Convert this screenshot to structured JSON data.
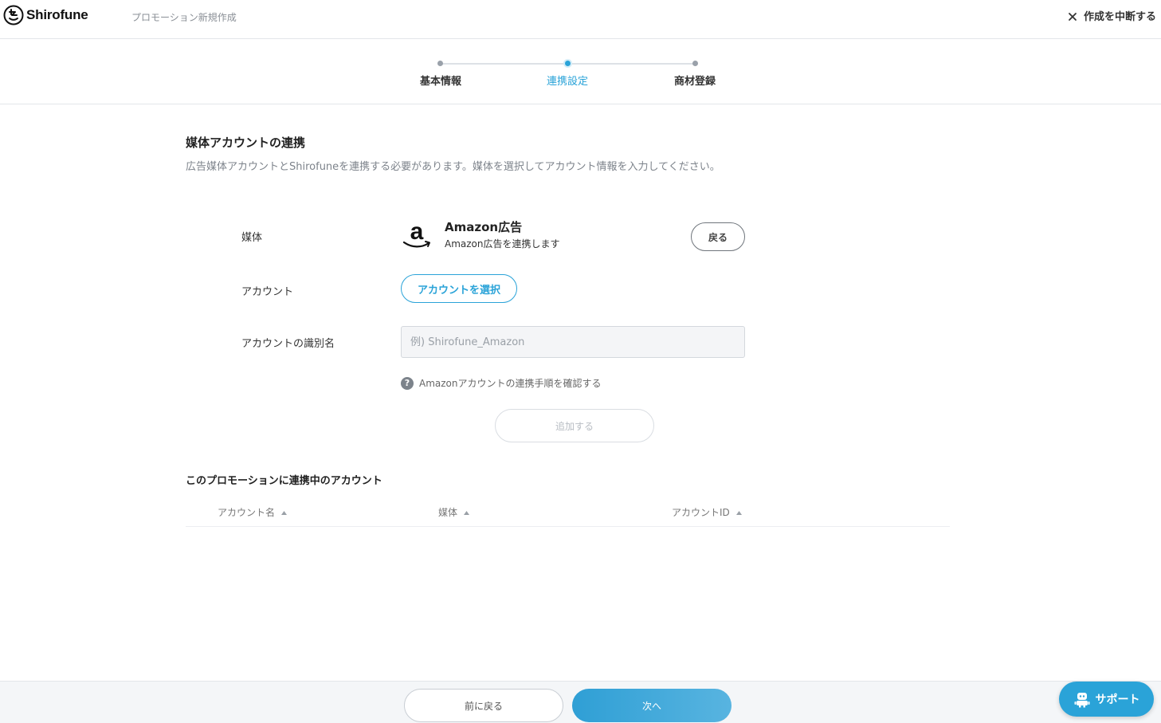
{
  "header": {
    "brand": "Shirofune",
    "title": "プロモーション新規作成",
    "abort_label": "作成を中断する",
    "abort_icon": "close-icon"
  },
  "stepper": {
    "steps": [
      {
        "label": "基本情報",
        "active": false
      },
      {
        "label": "連携設定",
        "active": true
      },
      {
        "label": "商材登録",
        "active": false
      }
    ],
    "active_color": "#2aa3d8"
  },
  "section": {
    "title": "媒体アカウントの連携",
    "description": "広告媒体アカウントとShirofuneを連携する必要があります。媒体を選択してアカウント情報を入力してください。"
  },
  "form": {
    "media_label": "媒体",
    "media": {
      "name": "Amazon広告",
      "sub": "Amazon広告を連携します",
      "icon": "amazon-logo-icon"
    },
    "back_label": "戻る",
    "account_label": "アカウント",
    "select_account_label": "アカウントを選択",
    "account_id_label": "アカウントの識別名",
    "account_id_placeholder": "例) Shirofune_Amazon",
    "account_id_value": "",
    "help_text": "Amazonアカウントの連携手順を確認する",
    "help_icon": "question-icon",
    "add_label": "追加する"
  },
  "linked": {
    "title": "このプロモーションに連携中のアカウント",
    "columns": [
      "アカウント名",
      "媒体",
      "アカウントID"
    ],
    "rows": []
  },
  "footer": {
    "prev_label": "前に戻る",
    "next_label": "次へ",
    "support_label": "サポート",
    "support_icon": "robot-icon"
  }
}
